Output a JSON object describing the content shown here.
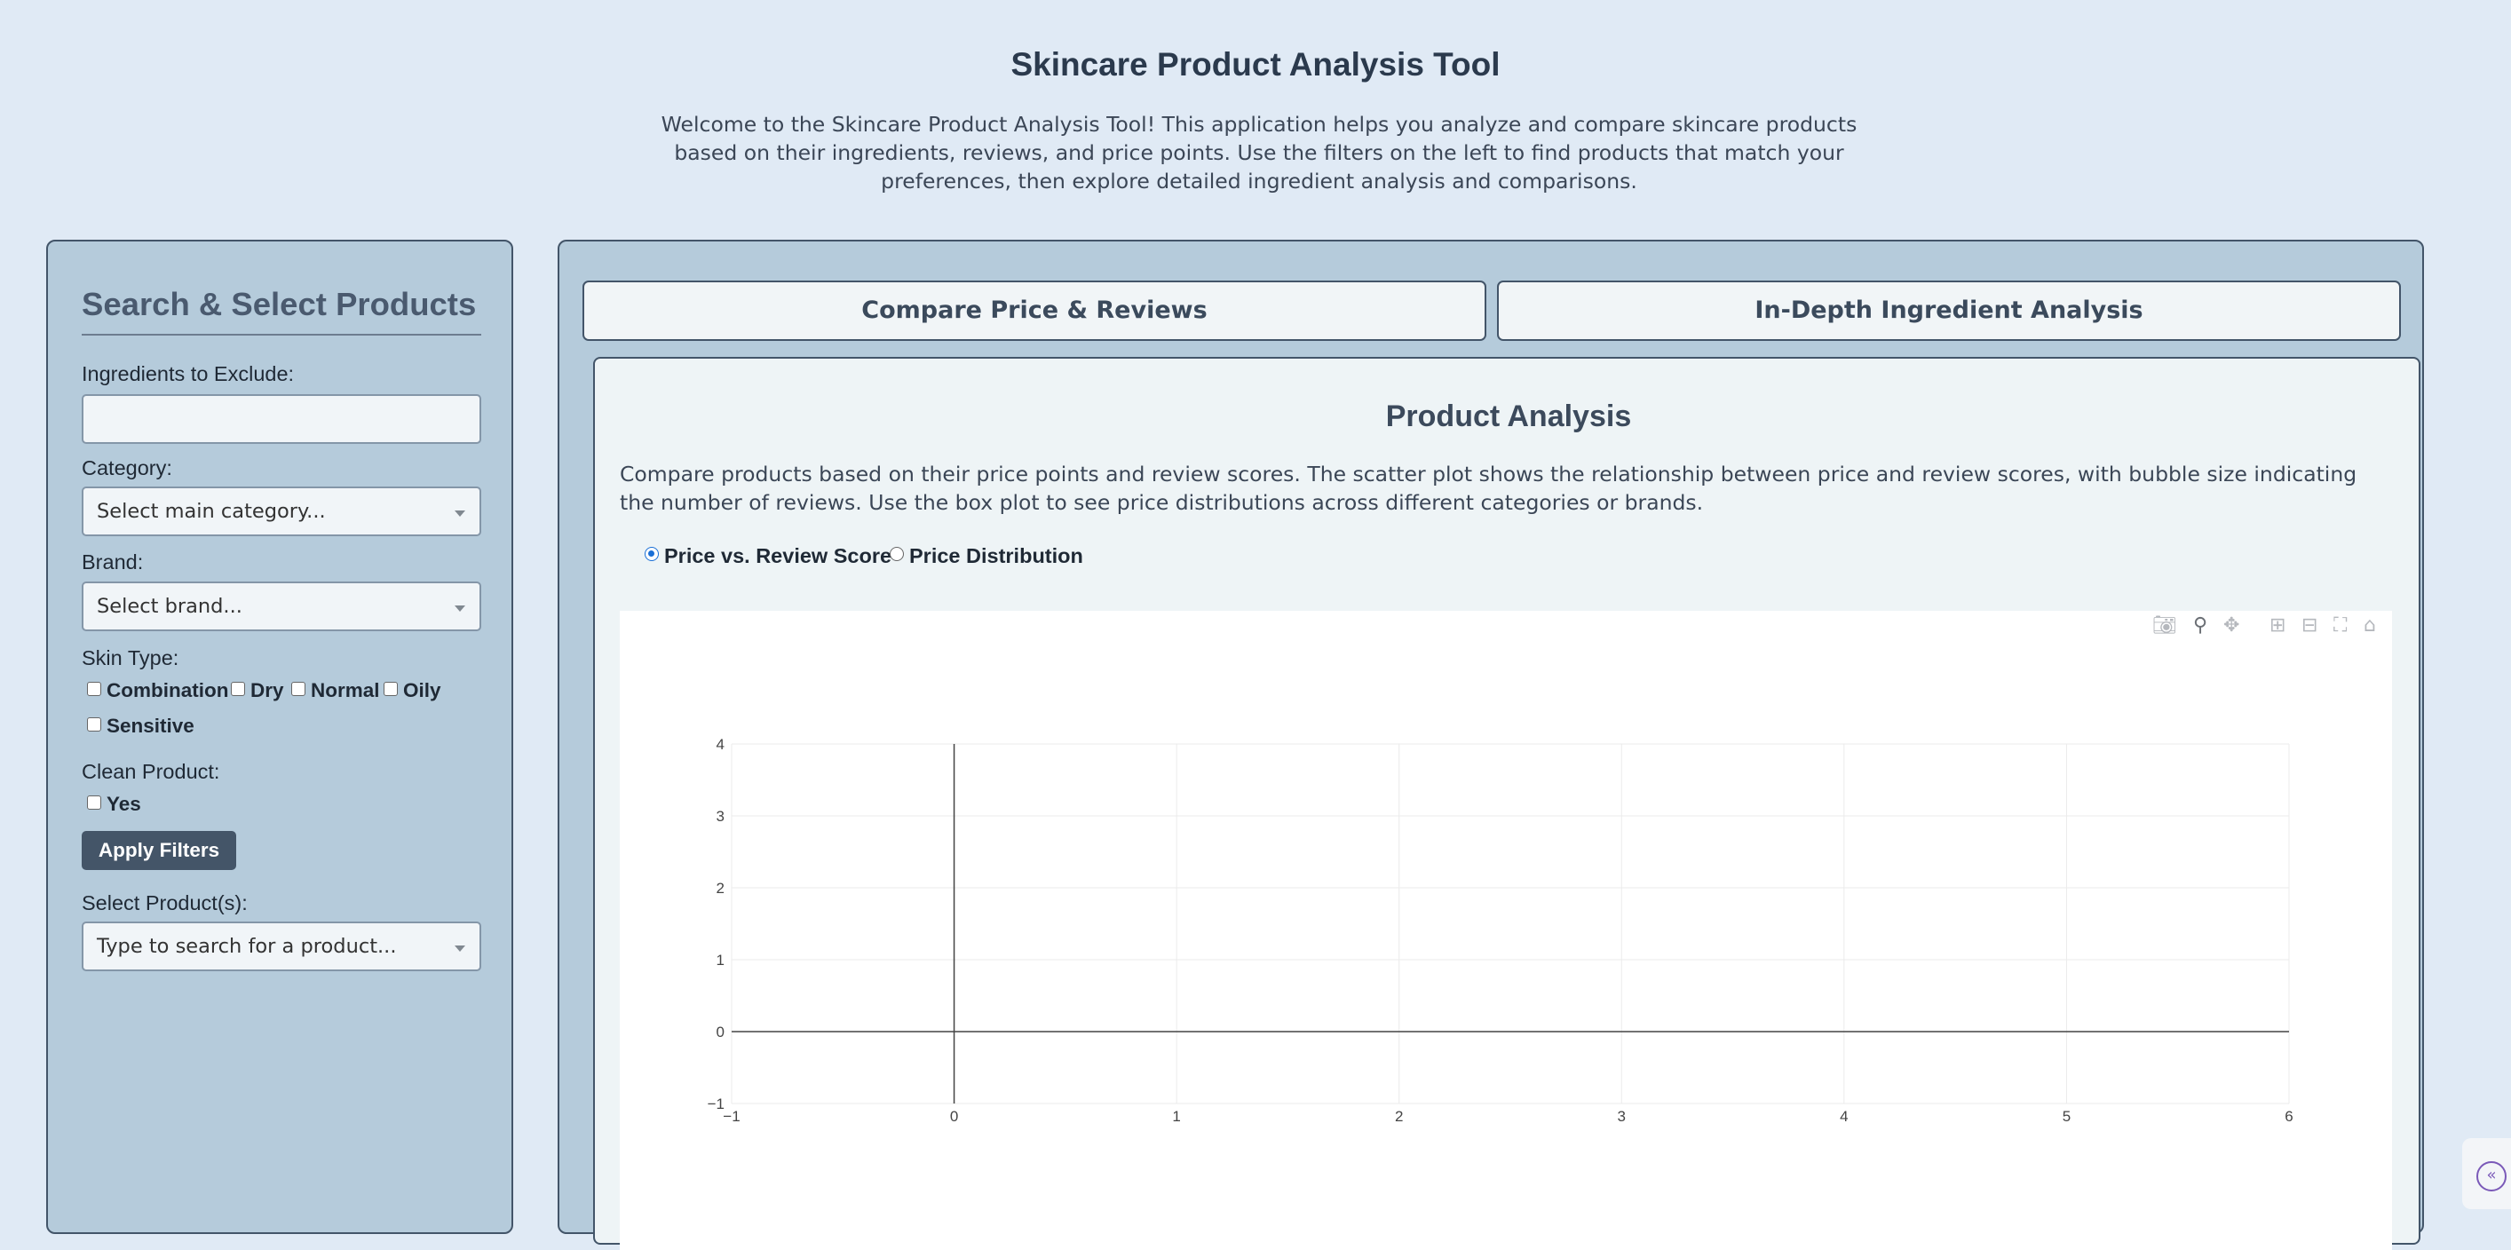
{
  "header": {
    "title": "Skincare Product Analysis Tool",
    "intro": "Welcome to the Skincare Product Analysis Tool! This application helps you analyze and compare skincare products based on their ingredients, reviews, and price points. Use the filters on the left to find products that match your preferences, then explore detailed ingredient analysis and comparisons."
  },
  "sidebar": {
    "title": "Search & Select Products",
    "exclude_label": "Ingredients to Exclude:",
    "exclude_value": "",
    "category_label": "Category:",
    "category_placeholder": "Select main category...",
    "brand_label": "Brand:",
    "brand_placeholder": "Select brand...",
    "skin_type_label": "Skin Type:",
    "skin_types": [
      "Combination",
      "Dry",
      "Normal",
      "Oily",
      "Sensitive"
    ],
    "clean_label": "Clean Product:",
    "clean_option": "Yes",
    "apply_label": "Apply Filters",
    "product_label": "Select Product(s):",
    "product_placeholder": "Type to search for a product..."
  },
  "tabs": [
    {
      "label": "Compare Price & Reviews"
    },
    {
      "label": "In-Depth Ingredient Analysis"
    }
  ],
  "analysis": {
    "title": "Product Analysis",
    "description": "Compare products based on their price points and review scores. The scatter plot shows the relationship between price and review scores, with bubble size indicating the number of reviews. Use the box plot to see price distributions across different categories or brands.",
    "plot_options": [
      {
        "label": "Price vs. Review Score",
        "selected": true
      },
      {
        "label": "Price Distribution",
        "selected": false
      }
    ]
  },
  "modebar": [
    "camera-icon",
    "zoom-icon",
    "pan-icon",
    "zoom-in-icon",
    "zoom-out-icon",
    "autoscale-icon",
    "reset-axes-icon"
  ],
  "chart_data": {
    "type": "scatter",
    "series": [],
    "xlim": [
      -1,
      6
    ],
    "ylim": [
      -1,
      4
    ],
    "xticks": [
      "−1",
      "0",
      "1",
      "2",
      "3",
      "4",
      "5",
      "6"
    ],
    "yticks": [
      "−1",
      "0",
      "1",
      "2",
      "3",
      "4"
    ],
    "grid": true,
    "title": "",
    "xlabel": "",
    "ylabel": ""
  }
}
